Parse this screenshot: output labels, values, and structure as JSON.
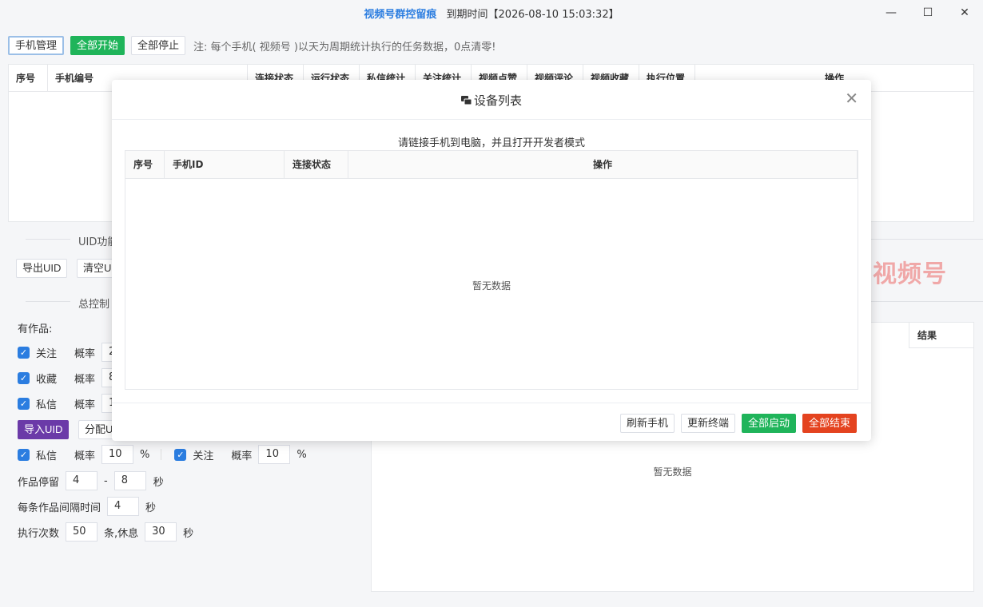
{
  "titlebar": {
    "app_name": "视频号群控留痕",
    "expiry": "到期时间【2026-08-10 15:03:32】",
    "minimize": "—",
    "maximize": "☐",
    "close": "✕"
  },
  "toolbar": {
    "phone_manage": "手机管理",
    "start_all": "全部开始",
    "stop_all": "全部停止",
    "note": "注: 每个手机( 视频号 )以天为周期统计执行的任务数据，0点清零!"
  },
  "main_table": {
    "columns": [
      "序号",
      "手机编号",
      "连接状态",
      "运行状态",
      "私信统计",
      "关注统计",
      "视频点赞",
      "视频评论",
      "视频收藏",
      "执行位置",
      "操作"
    ]
  },
  "uid_section": {
    "title": "UID功能",
    "export_uid": "导出UID",
    "clear_uid": "清空UID"
  },
  "control_section": {
    "title": "总控制",
    "has_works_label": "有作品:",
    "rows": [
      {
        "label": "关注",
        "rate_label": "概率",
        "rate": "20"
      },
      {
        "label": "收藏",
        "rate_label": "概率",
        "rate": "80"
      },
      {
        "label": "私信",
        "rate_label": "概率",
        "rate": "10"
      }
    ],
    "import_uid": "导入UID",
    "assign_uid": "分配UID",
    "dm_label": "私信",
    "dm_rate_label": "概率",
    "dm_rate": "10",
    "percent": "%",
    "follow_label": "关注",
    "follow_rate_label": "概率",
    "follow_rate": "10",
    "stay_label": "作品停留",
    "stay_min": "4",
    "stay_dash": "-",
    "stay_max": "8",
    "sec": "秒",
    "interval_label": "每条作品间隔时间",
    "interval_value": "4",
    "exec_label": "执行次数",
    "exec_count": "50",
    "exec_unit": "条,休息",
    "rest_value": "30"
  },
  "watermark": "视频号",
  "log_table": {
    "result_header": "结果",
    "empty_text": "暂无数据"
  },
  "dialog": {
    "title": "设备列表",
    "hint": "请链接手机到电脑，并且打开开发者模式",
    "columns": [
      "序号",
      "手机ID",
      "连接状态",
      "操作"
    ],
    "empty_text": "暂无数据",
    "close": "✕",
    "refresh": "刷新手机",
    "update_terminal": "更新终端",
    "start_all": "全部启动",
    "end_all": "全部结束"
  },
  "colors": {
    "accent": "#2b7de0",
    "green": "#1fb45a",
    "red": "#e4431f",
    "purple": "#6b3aa8"
  }
}
